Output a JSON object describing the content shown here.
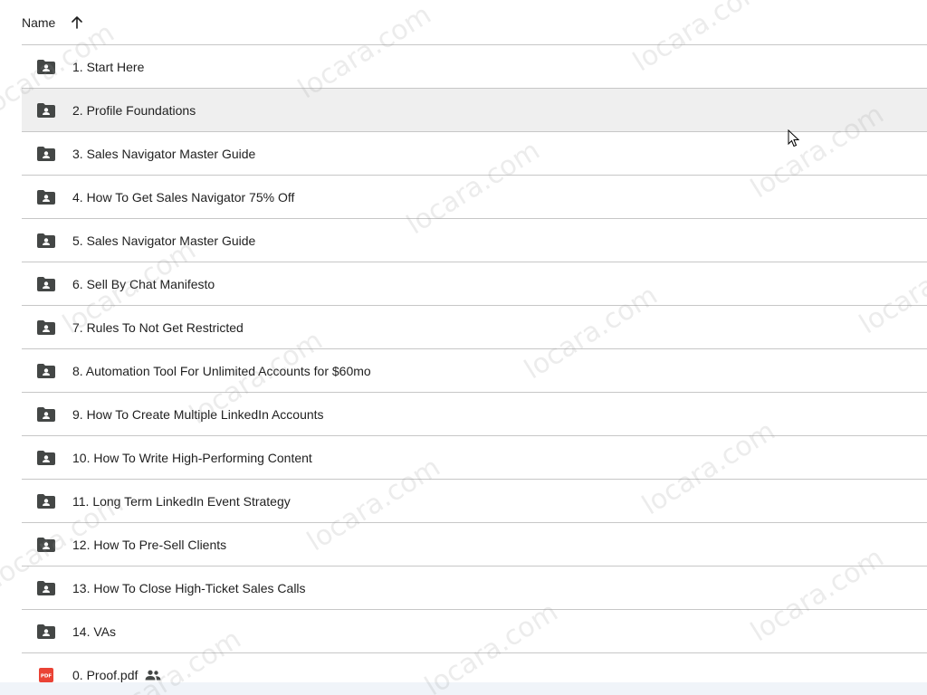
{
  "header": {
    "column_label": "Name"
  },
  "selected_index": 1,
  "items": [
    {
      "name": "1. Start Here",
      "type": "shared-folder"
    },
    {
      "name": "2. Profile Foundations",
      "type": "shared-folder"
    },
    {
      "name": "3. Sales Navigator Master Guide",
      "type": "shared-folder"
    },
    {
      "name": "4. How To Get Sales Navigator 75% Off",
      "type": "shared-folder"
    },
    {
      "name": "5. Sales Navigator Master Guide",
      "type": "shared-folder"
    },
    {
      "name": "6. Sell By Chat Manifesto",
      "type": "shared-folder"
    },
    {
      "name": "7. Rules To Not Get Restricted",
      "type": "shared-folder"
    },
    {
      "name": "8. Automation Tool For Unlimited Accounts for $60mo",
      "type": "shared-folder"
    },
    {
      "name": "9. How To Create Multiple LinkedIn Accounts",
      "type": "shared-folder"
    },
    {
      "name": "10. How To Write High-Performing Content",
      "type": "shared-folder"
    },
    {
      "name": "11. Long Term LinkedIn Event Strategy",
      "type": "shared-folder"
    },
    {
      "name": "12. How To Pre-Sell Clients",
      "type": "shared-folder"
    },
    {
      "name": "13. How To Close High-Ticket Sales Calls",
      "type": "shared-folder"
    },
    {
      "name": "14. VAs",
      "type": "shared-folder"
    },
    {
      "name": "0. Proof.pdf",
      "type": "pdf",
      "shared": true
    }
  ],
  "pdf_badge": "PDF",
  "watermark": "locara.com",
  "colors": {
    "folder_icon": "#444746",
    "pdf_icon": "#ea4335",
    "selected_row": "#efefef",
    "divider": "#c7c7c7"
  }
}
